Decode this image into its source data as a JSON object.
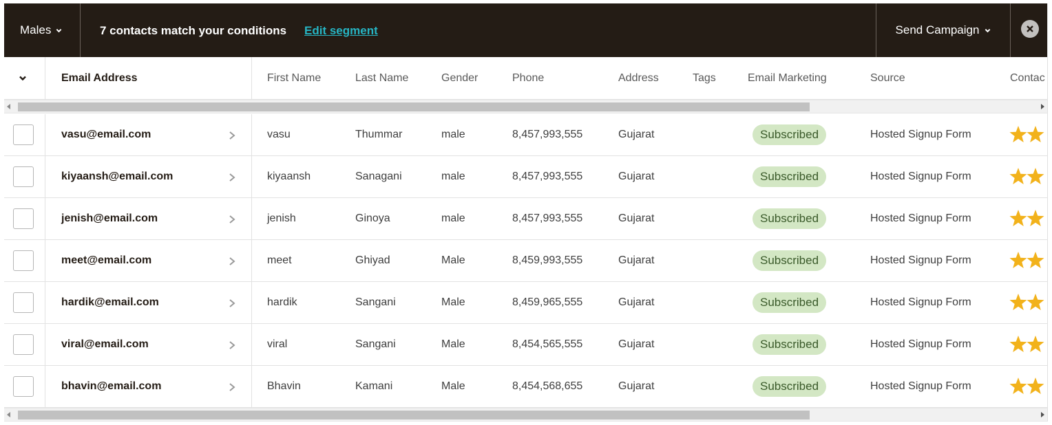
{
  "topbar": {
    "segment_label": "Males",
    "match_text": "7 contacts match your conditions",
    "edit_link": "Edit segment",
    "send_campaign": "Send Campaign"
  },
  "columns": [
    "Email Address",
    "First Name",
    "Last Name",
    "Gender",
    "Phone",
    "Address",
    "Tags",
    "Email Marketing",
    "Source",
    "Contac"
  ],
  "rows": [
    {
      "email": "vasu@email.com",
      "first": "vasu",
      "last": "Thummar",
      "gender": "male",
      "phone": "8,457,993,555",
      "address": "Gujarat",
      "status": "Subscribed",
      "source": "Hosted Signup Form",
      "rating": 2
    },
    {
      "email": "kiyaansh@email.com",
      "first": "kiyaansh",
      "last": "Sanagani",
      "gender": "male",
      "phone": "8,457,993,555",
      "address": "Gujarat",
      "status": "Subscribed",
      "source": "Hosted Signup Form",
      "rating": 2
    },
    {
      "email": "jenish@email.com",
      "first": "jenish",
      "last": "Ginoya",
      "gender": "male",
      "phone": "8,457,993,555",
      "address": "Gujarat",
      "status": "Subscribed",
      "source": "Hosted Signup Form",
      "rating": 2
    },
    {
      "email": "meet@email.com",
      "first": "meet",
      "last": "Ghiyad",
      "gender": "Male",
      "phone": "8,459,993,555",
      "address": "Gujarat",
      "status": "Subscribed",
      "source": "Hosted Signup Form",
      "rating": 2
    },
    {
      "email": "hardik@email.com",
      "first": "hardik",
      "last": "Sangani",
      "gender": "Male",
      "phone": "8,459,965,555",
      "address": "Gujarat",
      "status": "Subscribed",
      "source": "Hosted Signup Form",
      "rating": 2
    },
    {
      "email": "viral@email.com",
      "first": "viral",
      "last": "Sangani",
      "gender": "Male",
      "phone": "8,454,565,555",
      "address": "Gujarat",
      "status": "Subscribed",
      "source": "Hosted Signup Form",
      "rating": 2
    },
    {
      "email": "bhavin@email.com",
      "first": "Bhavin",
      "last": "Kamani",
      "gender": "Male",
      "phone": "8,454,568,655",
      "address": "Gujarat",
      "status": "Subscribed",
      "source": "Hosted Signup Form",
      "rating": 2
    }
  ],
  "colors": {
    "topbar_bg": "#241c15",
    "link": "#26b5c4",
    "badge_bg": "#d3e7c4",
    "star": "#f2b21b"
  },
  "icons": {
    "segment_chevron": "chevron-down-icon",
    "close": "close-circle-icon",
    "row_chevron": "chevron-right-icon",
    "rating": "star-icon"
  }
}
